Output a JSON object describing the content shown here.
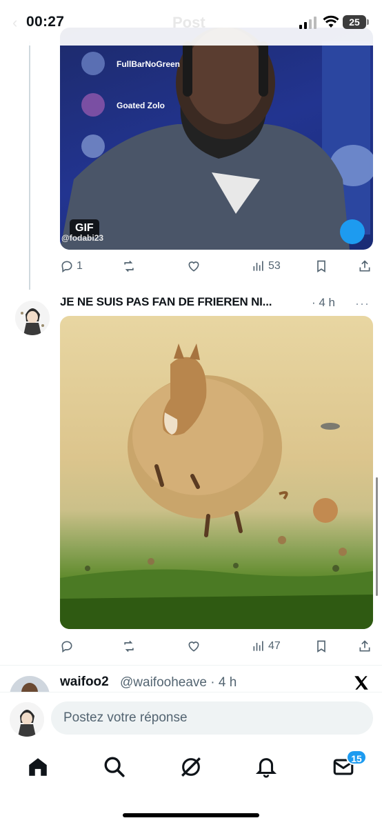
{
  "status_bar": {
    "time": "00:27",
    "battery": "25",
    "faded_title": "Post"
  },
  "tweet_1": {
    "media_badge": "GIF",
    "watermark": "@fodabi23",
    "stream_names": [
      "FullBarNoGreen",
      "Goated Zolo"
    ],
    "actions": {
      "replies": "1",
      "views": "53"
    }
  },
  "tweet_2": {
    "title": "JE NE SUIS PAS FAN DE FRIEREN NI...",
    "time": "· 4 h",
    "more": "···",
    "actions": {
      "views": "47"
    }
  },
  "tweet_3": {
    "name": "waifoo2",
    "handle": "@waifooheave · 4 h"
  },
  "reply": {
    "placeholder": "Postez votre réponse"
  },
  "tab_bar": {
    "notification_badge": "15"
  }
}
